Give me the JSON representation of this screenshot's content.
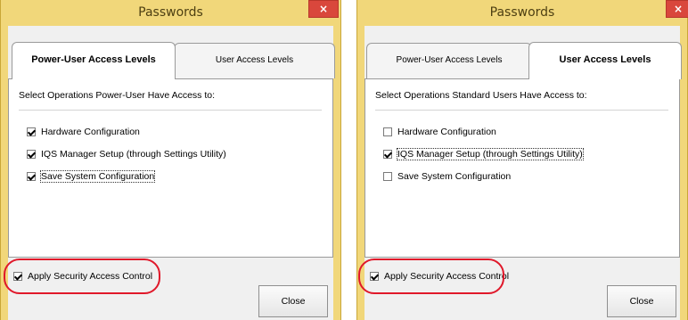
{
  "windows": [
    {
      "title": "Passwords",
      "close_glyph": "×",
      "tabs": [
        {
          "label": "Power-User Access Levels",
          "active": true
        },
        {
          "label": "User Access Levels",
          "active": false
        }
      ],
      "heading": "Select Operations Power-User Have Access to:",
      "options": [
        {
          "label": "Hardware Configuration",
          "checked": true
        },
        {
          "label": "IQS Manager Setup (through Settings Utility)",
          "checked": true
        },
        {
          "label": "Save System Configuration",
          "checked": true
        }
      ],
      "apply_label": "Apply Security Access Control",
      "apply_checked": true,
      "close_button": "Close"
    },
    {
      "title": "Passwords",
      "close_glyph": "×",
      "tabs": [
        {
          "label": "Power-User Access Levels",
          "active": false
        },
        {
          "label": "User Access Levels",
          "active": true
        }
      ],
      "heading": "Select Operations Standard Users Have Access to:",
      "options": [
        {
          "label": "Hardware Configuration",
          "checked": false
        },
        {
          "label": "IQS Manager Setup (through Settings Utility)",
          "checked": true
        },
        {
          "label": "Save System Configuration",
          "checked": false
        }
      ],
      "apply_label": "Apply Security Access Control",
      "apply_checked": true,
      "close_button": "Close"
    }
  ],
  "colors": {
    "title_bar": "#f1d77a",
    "close_button": "#d9473c",
    "highlight_ring": "#e0182a"
  }
}
